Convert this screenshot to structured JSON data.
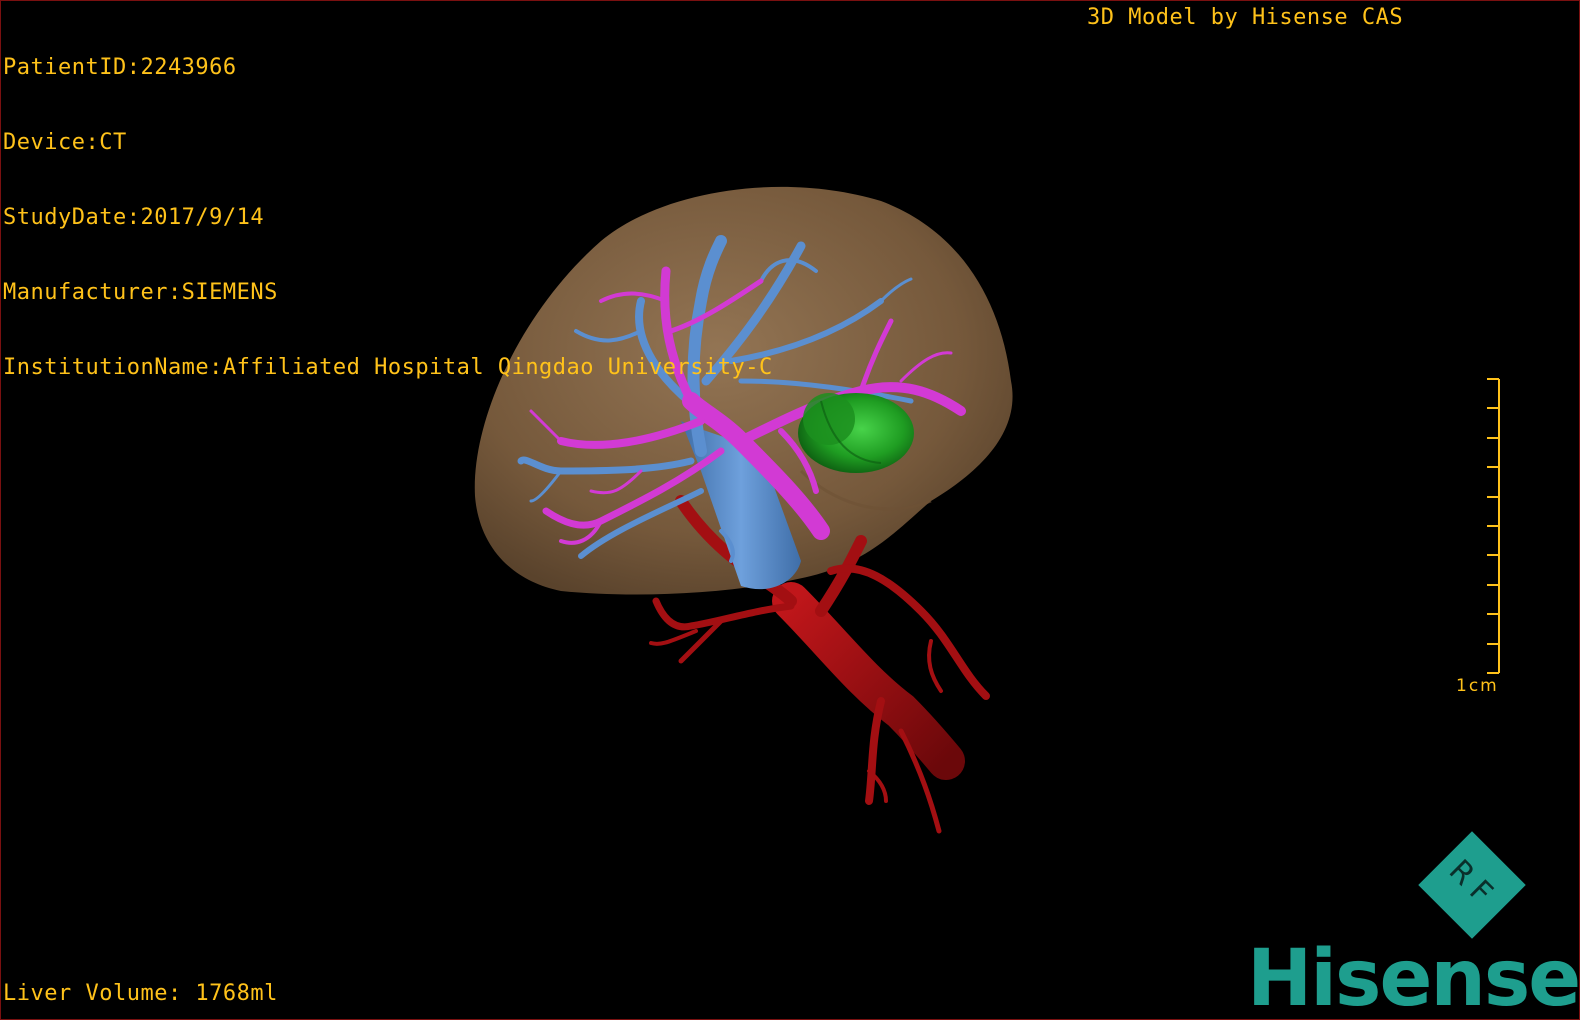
{
  "header": {
    "patient_id": "PatientID:2243966",
    "device": "Device:CT",
    "study_date": "StudyDate:2017/9/14",
    "manufacturer": "Manufacturer:SIEMENS",
    "institution": "InstitutionName:Affiliated Hospital Qingdao University-C",
    "credit": "3D Model by Hisense CAS"
  },
  "footer": {
    "liver_volume": "Liver Volume: 1768ml"
  },
  "scale_bar": {
    "label": "1cm"
  },
  "logo": {
    "word": "Hisense",
    "mark": "RF"
  },
  "colors": {
    "text": "#ffc21a",
    "liver": "#a07d56",
    "hepatic_vein": "#5b8fd0",
    "portal_vein": "#d23ad4",
    "artery": "#a30f12",
    "tumor": "#1fa322",
    "brand": "#1e9e8e",
    "frame": "#7a1010"
  },
  "icons": [
    "scale-bar-icon",
    "hisense-rf-logo-icon"
  ]
}
